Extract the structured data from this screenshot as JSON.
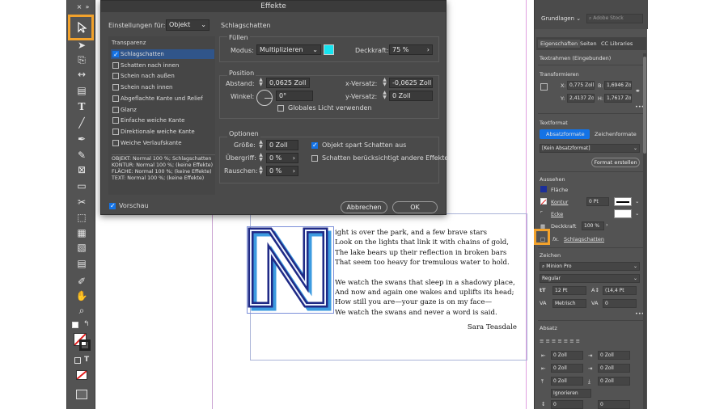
{
  "dialog": {
    "title": "Effekte",
    "settings_for_label": "Einstellungen für:",
    "settings_for_value": "Objekt",
    "effect_title": "Schlagschatten",
    "list_header": "Transparenz",
    "effects": [
      {
        "label": "Schlagschatten",
        "checked": true,
        "selected": true
      },
      {
        "label": "Schatten nach innen",
        "checked": false
      },
      {
        "label": "Schein nach außen",
        "checked": false
      },
      {
        "label": "Schein nach innen",
        "checked": false
      },
      {
        "label": "Abgeflachte Kante und Relief",
        "checked": false
      },
      {
        "label": "Glanz",
        "checked": false
      },
      {
        "label": "Einfache weiche Kante",
        "checked": false
      },
      {
        "label": "Direktionale weiche Kante",
        "checked": false
      },
      {
        "label": "Weiche Verlaufskante",
        "checked": false
      }
    ],
    "summary": [
      "OBJEKT: Normal 100 %; Schlagschatten",
      "KONTUR: Normal 100 %; (keine Effekte)",
      "FLÄCHE: Normal 100 %; (keine Effekte)",
      "TEXT: Normal 100 %; (keine Effekte)"
    ],
    "fuellen": {
      "header": "Füllen",
      "mode_label": "Modus:",
      "mode_value": "Multiplizieren",
      "swatch_color": "#16e4f0",
      "opacity_label": "Deckkraft:",
      "opacity_value": "75 %"
    },
    "position": {
      "header": "Position",
      "distance_label": "Abstand:",
      "distance_value": "0,0625 Zoll",
      "xoffset_label": "x-Versatz:",
      "xoffset_value": "-0,0625 Zoll",
      "angle_label": "Winkel:",
      "angle_value": "0°",
      "yoffset_label": "y-Versatz:",
      "yoffset_value": "0 Zoll",
      "global_light_label": "Globales Licht verwenden"
    },
    "optionen": {
      "header": "Optionen",
      "size_label": "Größe:",
      "size_value": "0 Zoll",
      "spread_label": "Übergriff:",
      "spread_value": "0 %",
      "noise_label": "Rauschen:",
      "noise_value": "0 %",
      "knockout_label": "Objekt spart Schatten aus",
      "honor_label": "Schatten berücksichtigt andere Effekte"
    },
    "preview_label": "Vorschau",
    "cancel_label": "Abbrechen",
    "ok_label": "OK"
  },
  "poem": {
    "stanza1": [
      "ight is over the park, and a few brave stars",
      "Look on the lights that link it with chains of gold,",
      "The lake bears up their reflection in broken bars",
      "That seem too heavy for tremulous water to hold."
    ],
    "stanza2": [
      "We watch the swans that sleep in a shadowy place,",
      "And now and again one wakes and uplifts its head;",
      "How still you are—your gaze is on my face—",
      "We watch the swans and never a word is said."
    ],
    "author": "Sara Teasdale"
  },
  "panel": {
    "workspace": "Grundlagen",
    "search_placeholder": "Adobe Stock",
    "tabs": [
      "Eigenschaften",
      "Seiten",
      "CC Libraries"
    ],
    "context": "Textrahmen (Eingebunden)",
    "transform_header": "Transformieren",
    "x_label": "X:",
    "x_value": "0,775 Zoll",
    "y_label": "Y:",
    "y_value": "2,4137 Zoll",
    "b_label": "B:",
    "b_value": "1,6946 Zoll",
    "h_label": "H:",
    "h_value": "1,7617 Zoll",
    "textformat_header": "Textformat",
    "para_style_tab": "Absatzformate",
    "char_style_tab": "Zeichenformate",
    "para_style_value": "[Kein Absatzformat]",
    "create_style": "Format erstellen",
    "aussehen_header": "Aussehen",
    "fill_label": "Fläche",
    "fill_color": "#1c2f9a",
    "stroke_label": "Kontur",
    "stroke_weight": "0 Pt",
    "corner_label": "Ecke",
    "opacity_label": "Deckkraft",
    "opacity_value": "100 %",
    "fx_label": "Schlagschatten",
    "zeichen_header": "Zeichen",
    "font_value": "Minion Pro",
    "font_style": "Regular",
    "font_size": "12 Pt",
    "leading": "(14,4 Pt",
    "kerning": "Metrisch",
    "tracking": "0",
    "absatz_header": "Absatz",
    "indent_values": [
      "0 Zoll",
      "0 Zoll",
      "0 Zoll",
      "0 Zoll",
      "0 Zoll",
      "0 Zoll"
    ],
    "hyphen_value": "Ignorieren",
    "extra_values": [
      "0",
      "0"
    ]
  }
}
